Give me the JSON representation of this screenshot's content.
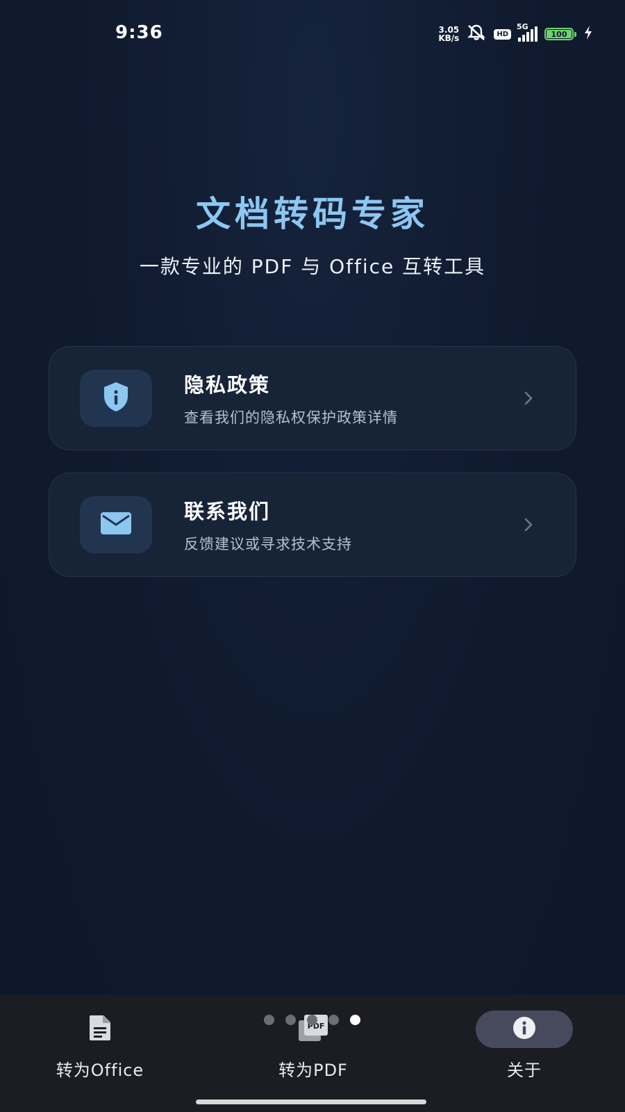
{
  "status_bar": {
    "time": "9:36",
    "net_speed_value": "3.05",
    "net_speed_unit": "KB/s",
    "hd": "HD",
    "network": "5G",
    "battery": "100"
  },
  "header": {
    "title": "文档转码专家",
    "subtitle": "一款专业的 PDF 与 Office 互转工具"
  },
  "cards": [
    {
      "title": "隐私政策",
      "description": "查看我们的隐私权保护政策详情",
      "icon": "shield-info-icon"
    },
    {
      "title": "联系我们",
      "description": "反馈建议或寻求技术支持",
      "icon": "mail-icon"
    }
  ],
  "bottom_nav": {
    "items": [
      {
        "label": "转为Office",
        "icon": "document-icon"
      },
      {
        "label": "转为PDF",
        "icon": "pdf-icon"
      },
      {
        "label": "关于",
        "icon": "info-icon"
      }
    ],
    "active_index": 2,
    "page_dot_count": 5,
    "active_dot_index": 4
  },
  "colors": {
    "background": "#0f1a2e",
    "accent": "#8cc7f2",
    "card": "#172337",
    "nav_active_pill": "#474a5c"
  }
}
